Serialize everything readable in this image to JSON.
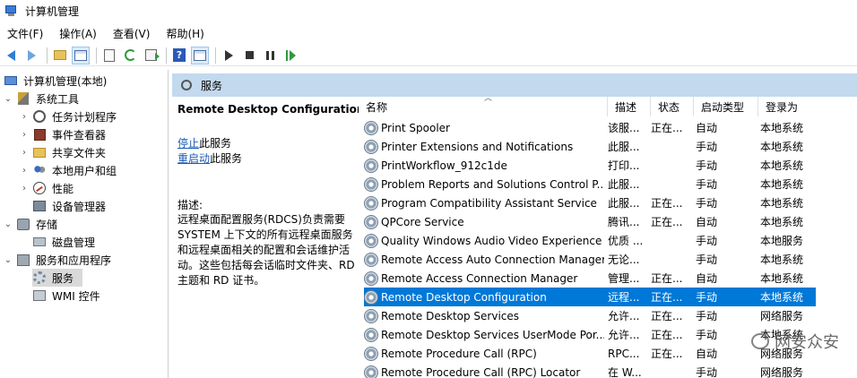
{
  "window": {
    "title": "计算机管理"
  },
  "menu": [
    "文件(F)",
    "操作(A)",
    "查看(V)",
    "帮助(H)"
  ],
  "toolbar": {
    "buttons": [
      "back-arrow-icon",
      "forward-arrow-icon",
      "up-folder-icon",
      "show-tree-icon",
      "properties-icon",
      "refresh-icon",
      "export-list-icon",
      "help-icon",
      "view-icon",
      "start-service-icon",
      "stop-service-icon",
      "pause-service-icon",
      "resume-service-icon"
    ]
  },
  "tree": {
    "root": "计算机管理(本地)",
    "system_tools": "系统工具",
    "task_scheduler": "任务计划程序",
    "event_viewer": "事件查看器",
    "shared_folders": "共享文件夹",
    "local_users": "本地用户和组",
    "performance": "性能",
    "device_manager": "设备管理器",
    "storage": "存储",
    "disk_mgmt": "磁盘管理",
    "services_apps": "服务和应用程序",
    "services": "服务",
    "wmi": "WMI 控件"
  },
  "services_pane": {
    "header": "服务",
    "selected_title": "Remote Desktop Configuration",
    "stop_link": "停止",
    "stop_suffix": "此服务",
    "restart_link": "重启动",
    "restart_suffix": "此服务",
    "desc_label": "描述:",
    "desc_lines": [
      "远程桌面配置服务(RDCS)负责需要",
      "SYSTEM 上下文的所有远程桌面服务",
      "和远程桌面相关的配置和会话维护活",
      "动。这些包括每会话临时文件夹、RD",
      "主题和 RD 证书。"
    ]
  },
  "columns": [
    "名称",
    "描述",
    "状态",
    "启动类型",
    "登录为"
  ],
  "rows": [
    [
      "Print Spooler",
      "该服...",
      "正在...",
      "自动",
      "本地系统"
    ],
    [
      "Printer Extensions and Notifications",
      "此服...",
      "",
      "手动",
      "本地系统"
    ],
    [
      "PrintWorkflow_912c1de",
      "打印...",
      "",
      "手动",
      "本地系统"
    ],
    [
      "Problem Reports and Solutions Control P...",
      "此服...",
      "",
      "手动",
      "本地系统"
    ],
    [
      "Program Compatibility Assistant Service",
      "此服...",
      "正在...",
      "手动",
      "本地系统"
    ],
    [
      "QPCore Service",
      "腾讯...",
      "正在...",
      "自动",
      "本地系统"
    ],
    [
      "Quality Windows Audio Video Experience",
      "优质 ...",
      "",
      "手动",
      "本地服务"
    ],
    [
      "Remote Access Auto Connection Manager",
      "无论...",
      "",
      "手动",
      "本地系统"
    ],
    [
      "Remote Access Connection Manager",
      "管理...",
      "正在...",
      "自动",
      "本地系统"
    ],
    [
      "Remote Desktop Configuration",
      "远程...",
      "正在...",
      "手动",
      "本地系统"
    ],
    [
      "Remote Desktop Services",
      "允许...",
      "正在...",
      "手动",
      "网络服务"
    ],
    [
      "Remote Desktop Services UserMode Por...",
      "允许...",
      "正在...",
      "手动",
      "本地系统"
    ],
    [
      "Remote Procedure Call (RPC)",
      "RPC...",
      "正在...",
      "自动",
      "网络服务"
    ],
    [
      "Remote Procedure Call (RPC) Locator",
      "在 W...",
      "",
      "手动",
      "网络服务"
    ]
  ],
  "selected_row_index": 9,
  "colors": {
    "selection": "#0078d7",
    "header_bar": "#c3d9ee",
    "link": "#1a5bb5"
  },
  "watermark": "网安众安"
}
